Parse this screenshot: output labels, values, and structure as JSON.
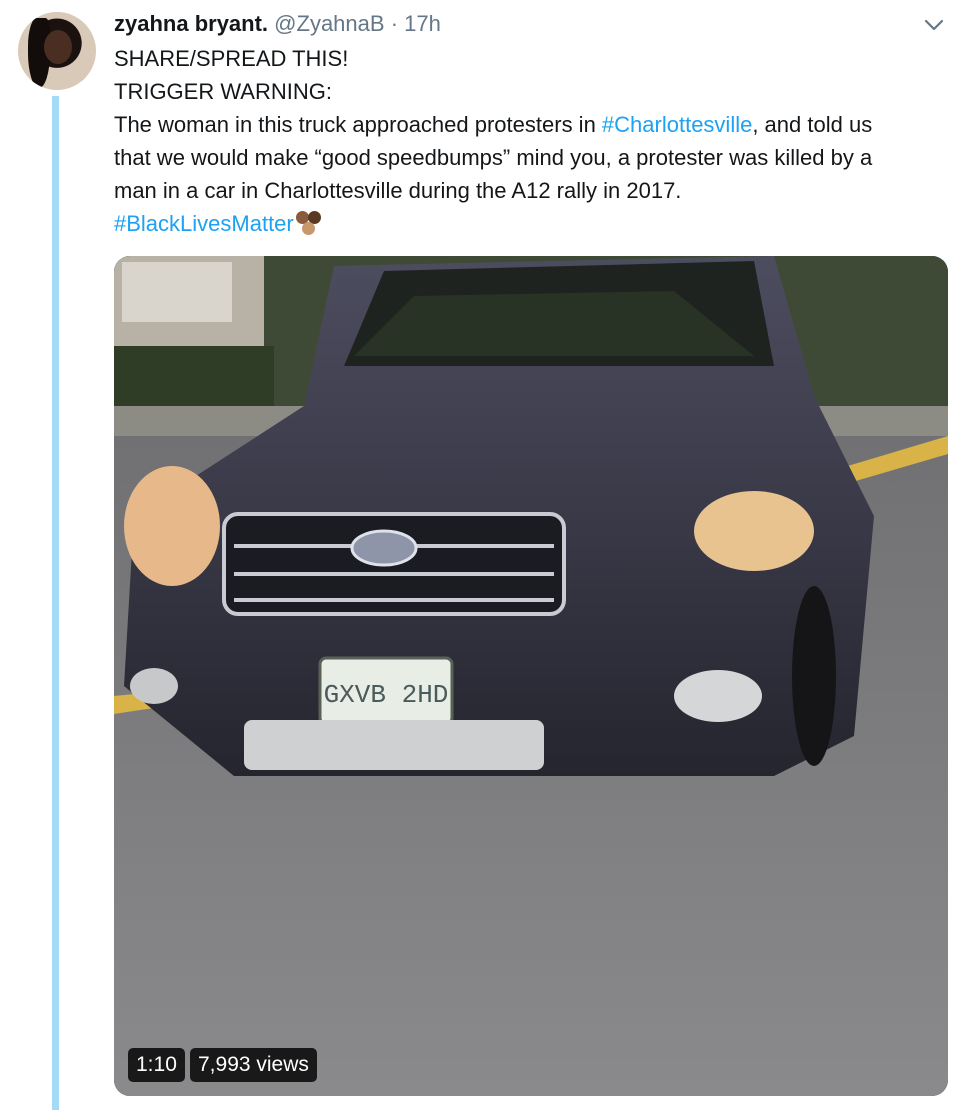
{
  "user": {
    "display_name": "zyahna bryant.",
    "handle": "@ZyahnaB",
    "separator": "·",
    "time": "17h"
  },
  "tweet": {
    "line1": "SHARE/SPREAD THIS!",
    "line2": "TRIGGER WARNING:",
    "line3_before": "The woman in this truck approached protesters in ",
    "line3_hashtag": "#Charlottesville",
    "line3_after": ", and told us",
    "line4": "that we would make “good speedbumps” mind you, a protester was killed by a",
    "line5": "man in a car in Charlottesville during the A12 rally in 2017.",
    "hashtag2": "#BlackLivesMatter"
  },
  "media": {
    "duration": "1:10",
    "views": "7,993 views",
    "plate_text": "GXVB 2HD"
  },
  "colors": {
    "link": "#1da1f2",
    "thread_line": "#a6dbf6",
    "muted": "#657786"
  },
  "icons": {
    "menu": "chevron-down-icon",
    "emoji": "raised-fists-emoji"
  }
}
